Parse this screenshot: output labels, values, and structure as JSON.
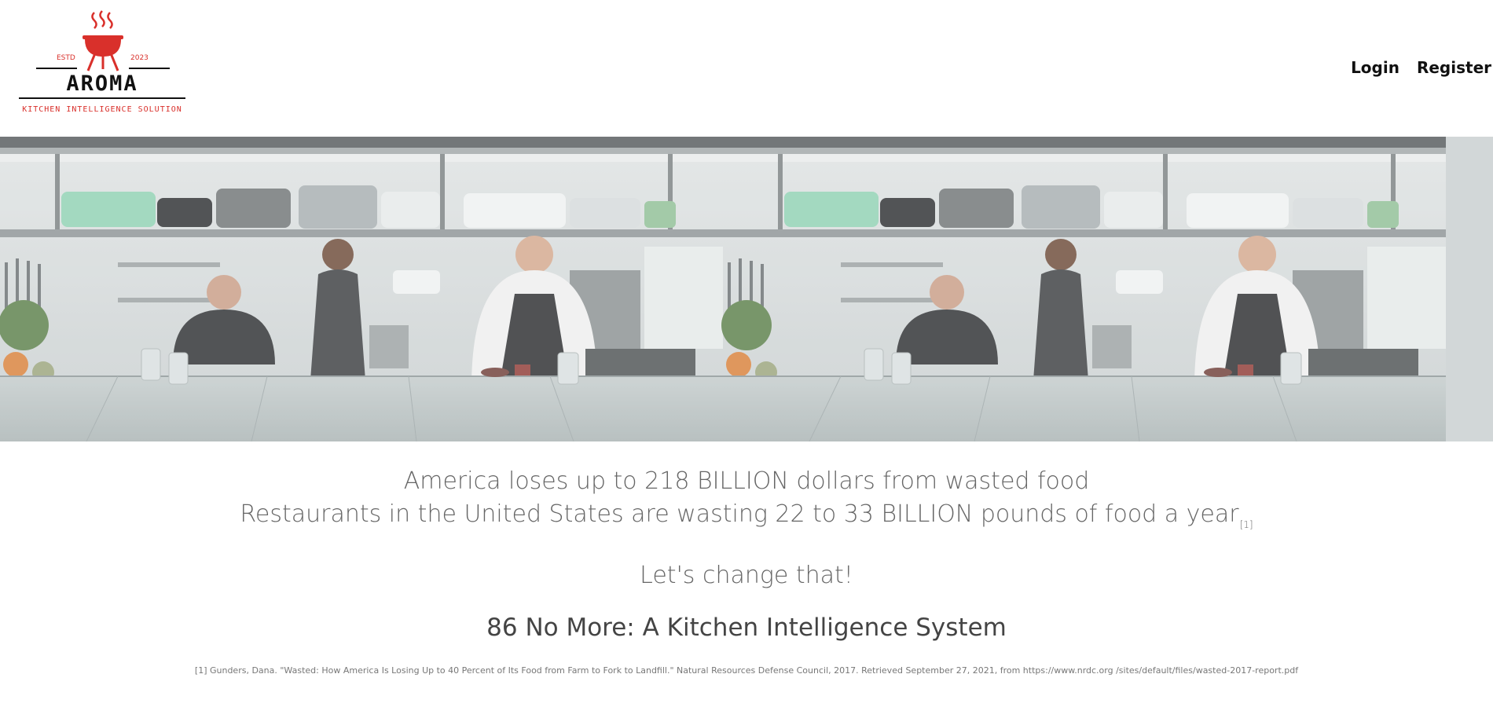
{
  "logo": {
    "estd": "ESTD",
    "year": "2023",
    "brand": "AROMA",
    "tagline": "KITCHEN INTELLIGENCE SOLUTION",
    "brand_color": "#d9302b"
  },
  "nav": {
    "login": "Login",
    "register": "Register"
  },
  "hero": {
    "image": "kitchen-chefs-photo"
  },
  "content": {
    "stat_line1": "America loses up to 218 BILLION dollars from wasted food",
    "stat_line2": "Restaurants in the United States are wasting 22 to 33 BILLION pounds of food a year",
    "stat_ref": "[1]",
    "call_to_action": "Let's change that!",
    "project_title": "86 No More: A Kitchen Intelligence System",
    "citation": "[1] Gunders, Dana. \"Wasted: How America Is Losing Up to 40 Percent of Its Food from Farm to Fork to Landfill.\" Natural Resources Defense Council, 2017. Retrieved September 27, 2021, from https://www.nrdc.org /sites/default/files/wasted-2017-report.pdf"
  }
}
